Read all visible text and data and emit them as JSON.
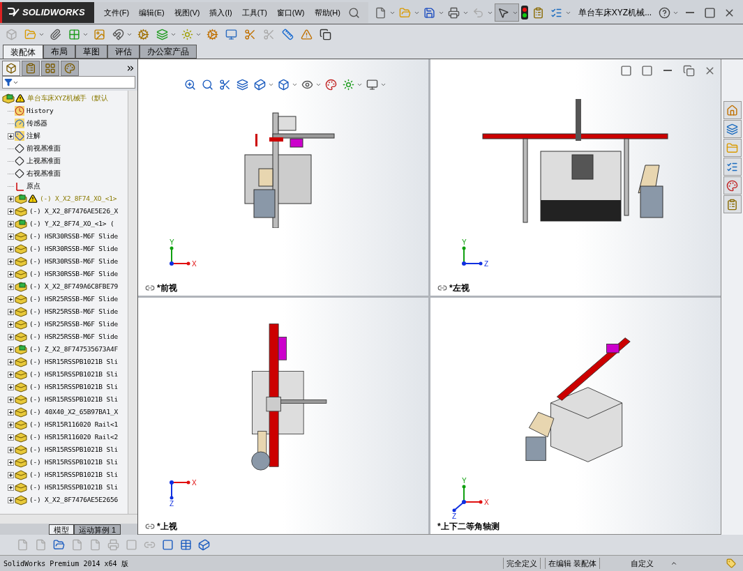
{
  "logo": "SOLIDWORKS",
  "menu": [
    "文件(F)",
    "编辑(E)",
    "视图(V)",
    "插入(I)",
    "工具(T)",
    "窗口(W)",
    "帮助(H)"
  ],
  "document_title": "单台车床XYZ机械...",
  "command_tabs": [
    {
      "label": "装配体",
      "selected": true
    },
    {
      "label": "布局",
      "selected": false
    },
    {
      "label": "草图",
      "selected": false
    },
    {
      "label": "评估",
      "selected": false
    },
    {
      "label": "办公室产品",
      "selected": false
    }
  ],
  "panel_tabs": [
    {
      "kind": "feature",
      "selected": true
    },
    {
      "kind": "property",
      "selected": false
    },
    {
      "kind": "config",
      "selected": false
    },
    {
      "kind": "display",
      "selected": false
    }
  ],
  "tree": {
    "label": "单台车床XYZ机械手  (默认",
    "kind": "assembly",
    "warning": true,
    "children": [
      {
        "label": "History",
        "kind": "history"
      },
      {
        "label": "传感器",
        "kind": "sensor"
      },
      {
        "label": "注解",
        "kind": "annotation",
        "expanded": false
      },
      {
        "label": "前视基准面",
        "kind": "plane"
      },
      {
        "label": "上视基准面",
        "kind": "plane"
      },
      {
        "label": "右视基准面",
        "kind": "plane"
      },
      {
        "label": "原点",
        "kind": "origin"
      },
      {
        "label": "(-) X_X2_8F74_XO_<1>",
        "kind": "assembly",
        "warning": true,
        "expanded": false
      },
      {
        "label": "(-) X_X2_8F7476AE5E26_X",
        "kind": "part",
        "expanded": false
      },
      {
        "label": "(-) Y_X2_8F74_XO_<1> (",
        "kind": "assembly",
        "expanded": false
      },
      {
        "label": "(-) HSR30RSSB-M6F Slide",
        "kind": "part",
        "expanded": false
      },
      {
        "label": "(-) HSR30RSSB-M6F Slide",
        "kind": "part",
        "expanded": false
      },
      {
        "label": "(-) HSR30RSSB-M6F Slide",
        "kind": "part",
        "expanded": false
      },
      {
        "label": "(-) HSR30RSSB-M6F Slide",
        "kind": "part",
        "expanded": false
      },
      {
        "label": "(-) X_X2_8F749A6C8FBE79",
        "kind": "assembly",
        "expanded": false
      },
      {
        "label": "(-) HSR25RSSB-M6F Slide",
        "kind": "part",
        "expanded": false
      },
      {
        "label": "(-) HSR25RSSB-M6F Slide",
        "kind": "part",
        "expanded": false
      },
      {
        "label": "(-) HSR25RSSB-M6F Slide",
        "kind": "part",
        "expanded": false
      },
      {
        "label": "(-) HSR25RSSB-M6F Slide",
        "kind": "part",
        "expanded": false
      },
      {
        "label": "(-) Z_X2_8F747535673A4F",
        "kind": "assembly",
        "expanded": false
      },
      {
        "label": "(-) HSR15RSSPB1021B Sli",
        "kind": "part",
        "expanded": false
      },
      {
        "label": "(-) HSR15RSSPB1021B Sli",
        "kind": "part",
        "expanded": false
      },
      {
        "label": "(-) HSR15RSSPB1021B Sli",
        "kind": "part",
        "expanded": false
      },
      {
        "label": "(-) HSR15RSSPB1021B Sli",
        "kind": "part",
        "expanded": false
      },
      {
        "label": "(-) 40X40_X2_65B97BA1_X",
        "kind": "part",
        "expanded": false
      },
      {
        "label": "(-) HSR15R116020 Rail<1",
        "kind": "part",
        "expanded": false
      },
      {
        "label": "(-) HSR15R116020 Rail<2",
        "kind": "part",
        "expanded": false
      },
      {
        "label": "(-) HSR15RSSPB1021B Sli",
        "kind": "part",
        "expanded": false
      },
      {
        "label": "(-) HSR15RSSPB1021B Sli",
        "kind": "part",
        "expanded": false
      },
      {
        "label": "(-) HSR15RSSPB1021B Sli",
        "kind": "part",
        "expanded": false
      },
      {
        "label": "(-) HSR15RSSPB1021B Sli",
        "kind": "part",
        "expanded": false
      },
      {
        "label": "(-) X_X2_8F7476AE5E2656",
        "kind": "part",
        "expanded": false
      }
    ]
  },
  "viewports": [
    {
      "label": "*前视",
      "kind": "front",
      "axes": [
        "Y",
        "X"
      ]
    },
    {
      "label": "*左视",
      "kind": "left",
      "axes": [
        "Y",
        "Z"
      ]
    },
    {
      "label": "*上视",
      "kind": "top",
      "axes": [
        "X",
        "Z"
      ]
    },
    {
      "label": "*上下二等角轴测",
      "kind": "iso",
      "axes": [
        "Y",
        "X",
        "Z"
      ]
    }
  ],
  "bottom_tabs": [
    {
      "label": "模型",
      "selected": true
    },
    {
      "label": "运动算例 1",
      "selected": false
    }
  ],
  "status_bar": [
    "SolidWorks Premium 2014 x64 版",
    "完全定义",
    "在编辑 装配体",
    "自定义"
  ]
}
